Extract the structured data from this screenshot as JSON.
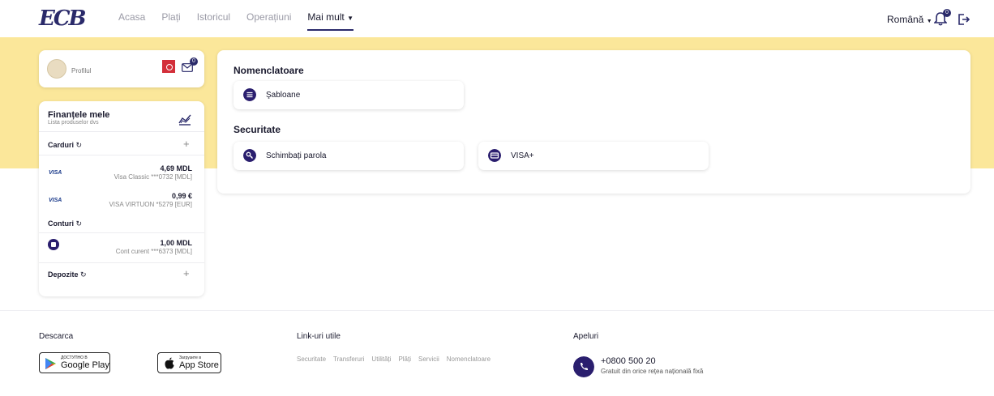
{
  "header": {
    "logo_text": "ECB",
    "nav": [
      "Acasa",
      "Plați",
      "Istoricul",
      "Operațiuni",
      "Mai mult"
    ],
    "active_nav": "Mai mult",
    "language": "Română",
    "notification_count": "0"
  },
  "profile": {
    "label": "Profilul",
    "mail_count": "0"
  },
  "finance": {
    "title": "Finanțele mele",
    "subtitle": "Lista produselor dvs",
    "cards_label": "Carduri",
    "cards": [
      {
        "brand": "VISA",
        "amount": "4,69 MDL",
        "name": "Visa Classic ***0732 [MDL]"
      },
      {
        "brand": "VISA",
        "amount": "0,99 €",
        "name": "VISA VIRTUON *5279 [EUR]"
      }
    ],
    "accounts_label": "Conturi",
    "accounts": [
      {
        "amount": "1,00 MDL",
        "name": "Cont curent ***6373 [MDL]"
      }
    ],
    "deposits_label": "Depozite"
  },
  "main": {
    "section1_title": "Nomenclatoare",
    "section1_items": [
      "Şabloane"
    ],
    "section2_title": "Securitate",
    "section2_items": [
      "Schimbați parola",
      "VISA+"
    ]
  },
  "footer": {
    "download_title": "Descarca",
    "google_small": "ДОСТУПНО В",
    "google_label": "Google Play",
    "apple_small": "Загрузите в",
    "apple_label": "App Store",
    "links_title": "Link-uri utile",
    "links": [
      "Securitate",
      "Transferuri",
      "Utilități",
      "Plăți",
      "Servicii",
      "Nomenclatoare"
    ],
    "calls_title": "Apeluri",
    "phone": "+0800 500 20",
    "phone_note": "Gratuit din orice rețea națională fixă"
  },
  "colors": {
    "accent": "#2a1e6e",
    "banner": "#fbe79a",
    "qr": "#d32f3a"
  }
}
